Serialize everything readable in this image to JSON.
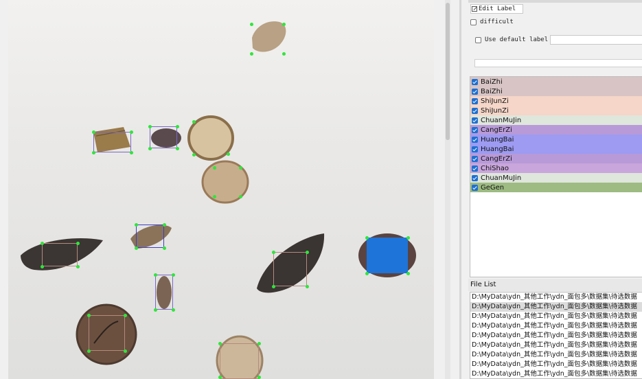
{
  "edit_label_button": "Edit Label",
  "difficult_label": "difficult",
  "use_default_label": "Use default label",
  "default_label_value": "",
  "label_list": [
    {
      "name": "BaiZhi",
      "color": "#d8c4c4"
    },
    {
      "name": "BaiZhi",
      "color": "#d8c4c4"
    },
    {
      "name": "ShiJunZi",
      "color": "#f5d6c8"
    },
    {
      "name": "ShiJunZi",
      "color": "#f5d6c8"
    },
    {
      "name": "ChuanMuJin",
      "color": "#dfe6dc"
    },
    {
      "name": "CangErZi",
      "color": "#b89ad8"
    },
    {
      "name": "HuangBai",
      "color": "#9d9bf2"
    },
    {
      "name": "HuangBai",
      "color": "#9d9bf2"
    },
    {
      "name": "CangErZi",
      "color": "#b89ad8"
    },
    {
      "name": "ChiShao",
      "color": "#c9a6db"
    },
    {
      "name": "ChuanMuJin",
      "color": "#dfe6dc"
    },
    {
      "name": "GeGen",
      "color": "#9dbb82"
    }
  ],
  "file_list_title": "File List",
  "file_list": [
    "D:\\MyData\\ydn_其他工作\\ydn_面包多\\数据集\\待选数据",
    "D:\\MyData\\ydn_其他工作\\ydn_面包多\\数据集\\待选数据",
    "D:\\MyData\\ydn_其他工作\\ydn_面包多\\数据集\\待选数据",
    "D:\\MyData\\ydn_其他工作\\ydn_面包多\\数据集\\待选数据",
    "D:\\MyData\\ydn_其他工作\\ydn_面包多\\数据集\\待选数据",
    "D:\\MyData\\ydn_其他工作\\ydn_面包多\\数据集\\待选数据",
    "D:\\MyData\\ydn_其他工作\\ydn_面包多\\数据集\\待选数据",
    "D:\\MyData\\ydn_其他工作\\ydn_面包多\\数据集\\待选数据",
    "D:\\MyData\\ydn_其他工作\\ydn_面包多\\数据集\\待选数据"
  ],
  "selected_file_index": 1,
  "colors": {
    "point": "#2ee63b",
    "selected_fill": "#1e74d8",
    "checkbox": "#1f6fd1"
  }
}
